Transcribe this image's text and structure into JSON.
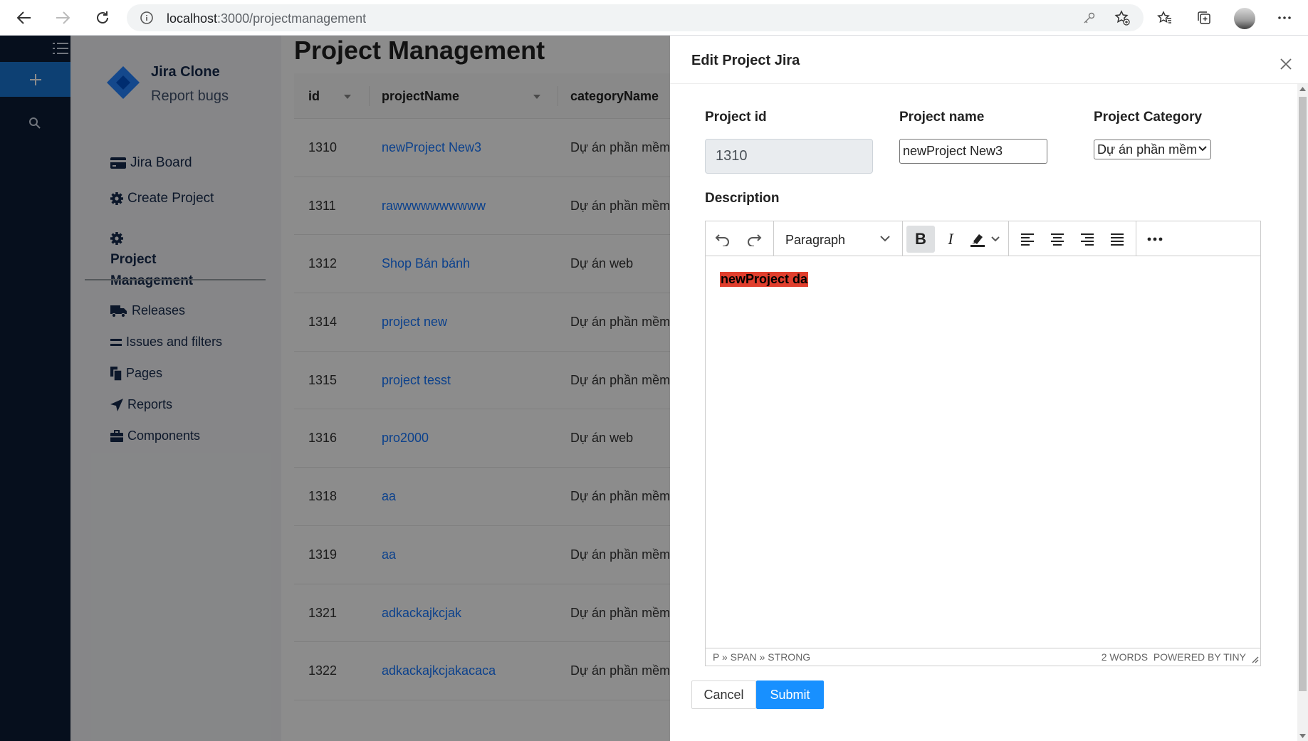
{
  "browser": {
    "url_host": "localhost",
    "url_path": ":3000/projectmanagement"
  },
  "app": {
    "brand_title": "Jira Clone",
    "brand_subtitle": "Report bugs",
    "nav_items": [
      {
        "label": "Jira Board",
        "icon": "credit-card-icon"
      },
      {
        "label": "Create Project",
        "icon": "gear-icon"
      },
      {
        "label": "Project Management",
        "icon": "gear-icon"
      }
    ],
    "secondary_items": [
      {
        "label": "Releases",
        "icon": "truck-icon"
      },
      {
        "label": "Issues and filters",
        "icon": "equals-icon"
      },
      {
        "label": "Pages",
        "icon": "copy-icon"
      },
      {
        "label": "Reports",
        "icon": "location-arrow-icon"
      },
      {
        "label": "Components",
        "icon": "briefcase-icon"
      }
    ],
    "page_title": "Project Management",
    "table": {
      "columns": [
        "id",
        "projectName",
        "categoryName"
      ],
      "rows": [
        {
          "id": "1310",
          "projectName": "newProject New3",
          "categoryName": "Dự án phần mềm"
        },
        {
          "id": "1311",
          "projectName": "rawwwwwwwwww",
          "categoryName": "Dự án phần mềm"
        },
        {
          "id": "1312",
          "projectName": "Shop Bán bánh",
          "categoryName": "Dự án web"
        },
        {
          "id": "1314",
          "projectName": "project new",
          "categoryName": "Dự án phần mềm"
        },
        {
          "id": "1315",
          "projectName": "project tesst",
          "categoryName": "Dự án phần mềm"
        },
        {
          "id": "1316",
          "projectName": "pro2000",
          "categoryName": "Dự án web"
        },
        {
          "id": "1318",
          "projectName": "aa",
          "categoryName": "Dự án phần mềm"
        },
        {
          "id": "1319",
          "projectName": "aa",
          "categoryName": "Dự án phần mềm"
        },
        {
          "id": "1321",
          "projectName": "adkackajkcjak",
          "categoryName": "Dự án phần mềm"
        },
        {
          "id": "1322",
          "projectName": "adkackajkcjakacaca",
          "categoryName": "Dự án phần mềm"
        }
      ]
    }
  },
  "drawer": {
    "title": "Edit Project Jira",
    "project_id_label": "Project id",
    "project_id_value": "1310",
    "project_name_label": "Project name",
    "project_name_value": "newProject New3",
    "project_category_label": "Project Category",
    "project_category_value": "Dự án phần mềm",
    "description_label": "Description",
    "editor": {
      "block_format": "Paragraph",
      "content_text": "newProject da",
      "highlight_color": "#e03e2d",
      "element_path": "P » SPAN » STRONG",
      "word_count": "2 WORDS",
      "powered_by": "POWERED BY TINY"
    },
    "cancel_label": "Cancel",
    "submit_label": "Submit"
  },
  "colors": {
    "rail_bg": "#0b1d36",
    "accent": "#1976d2",
    "submit_bg": "#1890ff",
    "link": "#1677ff"
  }
}
